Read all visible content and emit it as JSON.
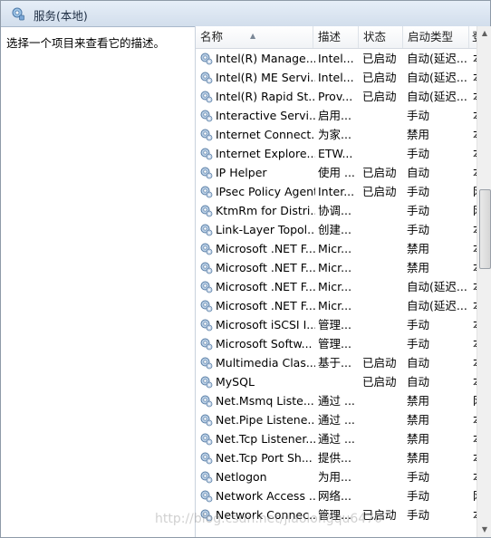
{
  "window": {
    "title": "服务(本地)",
    "description_hint": "选择一个项目来查看它的描述。"
  },
  "columns": [
    {
      "label": "名称"
    },
    {
      "label": "描述"
    },
    {
      "label": "状态"
    },
    {
      "label": "启动类型"
    },
    {
      "label": "登"
    }
  ],
  "services": [
    {
      "name": "Intel(R) Manage...",
      "desc": "Intel...",
      "status": "已启动",
      "startup": "自动(延迟...",
      "extra": "本"
    },
    {
      "name": "Intel(R) ME Servi...",
      "desc": "Intel...",
      "status": "已启动",
      "startup": "自动(延迟...",
      "extra": "本"
    },
    {
      "name": "Intel(R) Rapid St...",
      "desc": "Prov...",
      "status": "已启动",
      "startup": "自动(延迟...",
      "extra": "本"
    },
    {
      "name": "Interactive Servi...",
      "desc": "启用...",
      "status": "",
      "startup": "手动",
      "extra": "本"
    },
    {
      "name": "Internet Connect...",
      "desc": "为家...",
      "status": "",
      "startup": "禁用",
      "extra": "本"
    },
    {
      "name": "Internet Explore...",
      "desc": "ETW...",
      "status": "",
      "startup": "手动",
      "extra": "本"
    },
    {
      "name": "IP Helper",
      "desc": "使用 ...",
      "status": "已启动",
      "startup": "自动",
      "extra": "本"
    },
    {
      "name": "IPsec Policy Agent",
      "desc": "Inter...",
      "status": "已启动",
      "startup": "手动",
      "extra": "网"
    },
    {
      "name": "KtmRm for Distri...",
      "desc": "协调...",
      "status": "",
      "startup": "手动",
      "extra": "网"
    },
    {
      "name": "Link-Layer Topol...",
      "desc": "创建...",
      "status": "",
      "startup": "手动",
      "extra": "本"
    },
    {
      "name": "Microsoft .NET F...",
      "desc": "Micr...",
      "status": "",
      "startup": "禁用",
      "extra": "本"
    },
    {
      "name": "Microsoft .NET F...",
      "desc": "Micr...",
      "status": "",
      "startup": "禁用",
      "extra": "本"
    },
    {
      "name": "Microsoft .NET F...",
      "desc": "Micr...",
      "status": "",
      "startup": "自动(延迟...",
      "extra": "本"
    },
    {
      "name": "Microsoft .NET F...",
      "desc": "Micr...",
      "status": "",
      "startup": "自动(延迟...",
      "extra": "本"
    },
    {
      "name": "Microsoft iSCSI I...",
      "desc": "管理...",
      "status": "",
      "startup": "手动",
      "extra": "本"
    },
    {
      "name": "Microsoft Softw...",
      "desc": "管理...",
      "status": "",
      "startup": "手动",
      "extra": "本"
    },
    {
      "name": "Multimedia Clas...",
      "desc": "基于...",
      "status": "已启动",
      "startup": "自动",
      "extra": "本"
    },
    {
      "name": "MySQL",
      "desc": "",
      "status": "已启动",
      "startup": "自动",
      "extra": "本"
    },
    {
      "name": "Net.Msmq Liste...",
      "desc": "通过 ...",
      "status": "",
      "startup": "禁用",
      "extra": "网"
    },
    {
      "name": "Net.Pipe Listene...",
      "desc": "通过 ...",
      "status": "",
      "startup": "禁用",
      "extra": "本"
    },
    {
      "name": "Net.Tcp Listener...",
      "desc": "通过 ...",
      "status": "",
      "startup": "禁用",
      "extra": "本"
    },
    {
      "name": "Net.Tcp Port Sh...",
      "desc": "提供...",
      "status": "",
      "startup": "禁用",
      "extra": "本"
    },
    {
      "name": "Netlogon",
      "desc": "为用...",
      "status": "",
      "startup": "手动",
      "extra": "本"
    },
    {
      "name": "Network Access ...",
      "desc": "网络...",
      "status": "",
      "startup": "手动",
      "extra": "网"
    },
    {
      "name": "Network Connec...",
      "desc": "管理...",
      "status": "已启动",
      "startup": "手动",
      "extra": "本"
    }
  ],
  "watermark": "http://blog.csdn.net/jiaolongqu6470"
}
